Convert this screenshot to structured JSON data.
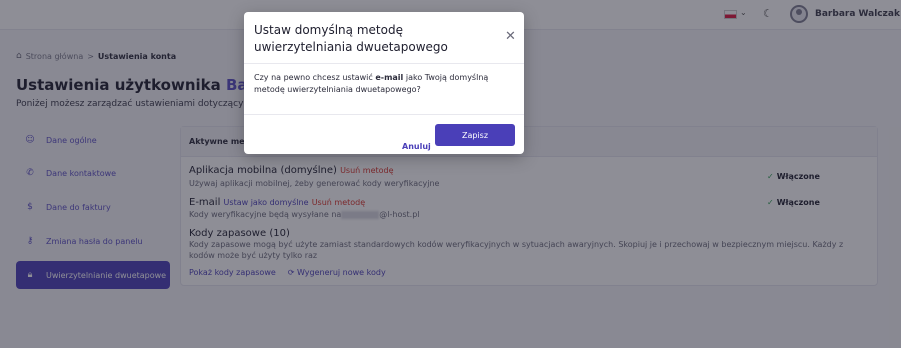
{
  "header": {
    "flag_icon": "poland-flag-icon",
    "user_name": "Barbara Walczak"
  },
  "breadcrumb": {
    "home": "Strona główna",
    "separator": ">",
    "current": "Ustawienia konta"
  },
  "page": {
    "title_prefix": "Ustawienia użytkownika",
    "title_user": "Barbara W",
    "subtitle": "Poniżej możesz zarządzać ustawieniami dotyczącymi T"
  },
  "sidebar": {
    "items": [
      {
        "label": "Dane ogólne",
        "icon": "user-icon"
      },
      {
        "label": "Dane kontaktowe",
        "icon": "phone-icon"
      },
      {
        "label": "Dane do faktury",
        "icon": "dollar-icon"
      },
      {
        "label": "Zmiana hasła do panelu",
        "icon": "key-icon"
      },
      {
        "label": "Uwierzytelnianie dwuetapowe",
        "icon": "lock-icon",
        "active": true
      }
    ]
  },
  "card": {
    "header": "Aktywne meto",
    "methods": [
      {
        "title": "Aplikacja mobilna (domyślne)",
        "remove": "Usuń metodę",
        "desc": "Używaj aplikacji mobilnej, żeby generować kody weryfikacyjne",
        "status": "Włączone"
      },
      {
        "title": "E-mail",
        "set_default": "Ustaw jako domyślne",
        "remove": "Usuń metodę",
        "desc_prefix": "Kody weryfikacyjne będą wysyłane na",
        "desc_suffix": "@l-host.pl",
        "status": "Włączone"
      }
    ],
    "backup": {
      "title": "Kody zapasowe (10)",
      "desc": "Kody zapasowe mogą być użyte zamiast standardowych kodów weryfikacyjnych w sytuacjach awaryjnych. Skopiuj je i przechowaj w bezpiecznym miejscu. Każdy z kodów może być użyty tylko raz",
      "show": "Pokaż kody zapasowe",
      "regenerate": "Wygeneruj nowe kody"
    }
  },
  "modal": {
    "title": "Ustaw domyślną metodę uwierzytelniania dwuetapowego",
    "body_prefix": "Czy na pewno chcesz ustawić",
    "body_bold": "e-mail",
    "body_suffix": "jako Twoją domyślną metodę uwierzytelniania dwuetapowego?",
    "cancel": "Anuluj",
    "save": "Zapisz"
  }
}
